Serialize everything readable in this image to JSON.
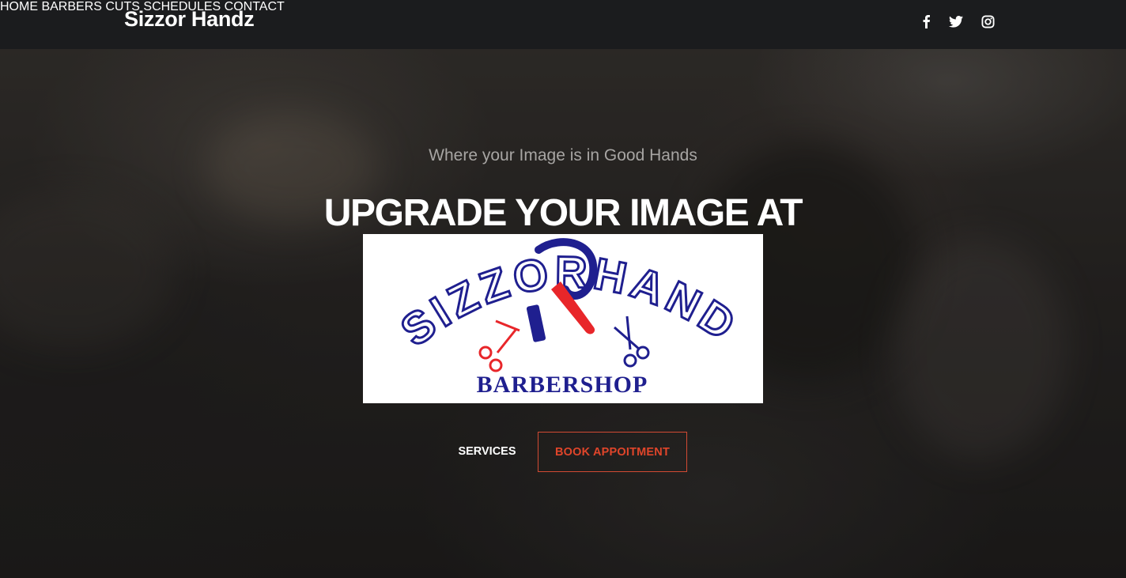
{
  "header": {
    "brand": "Sizzor Handz",
    "nav": [
      {
        "label": "HOME"
      },
      {
        "label": "BARBERS"
      },
      {
        "label": "CUTS"
      },
      {
        "label": "SCHEDULES"
      },
      {
        "label": "CONTACT"
      }
    ],
    "social": [
      {
        "icon": "facebook-icon"
      },
      {
        "icon": "twitter-icon"
      },
      {
        "icon": "instagram-icon"
      }
    ]
  },
  "hero": {
    "tagline": "Where your Image is in Good Hands",
    "headline": "UPGRADE YOUR IMAGE AT",
    "logo": {
      "top_text": "SIZZORHANDZ",
      "bottom_text": "BARBERSHOP"
    },
    "buttons": {
      "services": "SERVICES",
      "book": "BOOK APPOITMENT"
    }
  },
  "colors": {
    "accent": "#e0452a",
    "logo_blue": "#1f1f8f",
    "logo_red": "#e8262a",
    "header_bg": "#1b1c1e"
  }
}
